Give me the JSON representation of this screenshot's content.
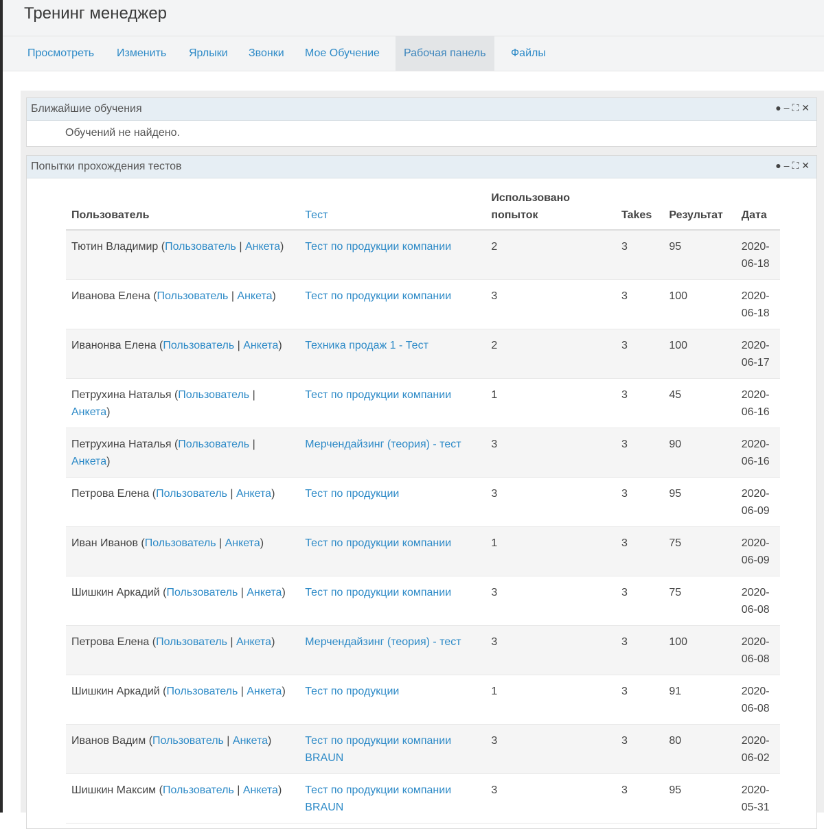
{
  "app": {
    "title": "Тренинг менеджер"
  },
  "tabs": [
    {
      "label": "Просмотреть"
    },
    {
      "label": "Изменить"
    },
    {
      "label": "Ярлыки"
    },
    {
      "label": "Звонки"
    },
    {
      "label": "Мое Обучение"
    },
    {
      "label": "Рабочая панель",
      "active": true
    },
    {
      "label": "Файлы"
    }
  ],
  "block_icons": [
    "settings-icon",
    "minimize-icon",
    "expand-icon",
    "close-icon"
  ],
  "upcoming": {
    "title": "Ближайшие обучения",
    "empty": "Обучений не найдено."
  },
  "attempts": {
    "title": "Попытки прохождения тестов",
    "links": {
      "user": "Пользователь",
      "profile": "Анкета",
      "sep": " | "
    },
    "columns": {
      "user": "Пользователь",
      "test": "Тест",
      "used": "Использовано попыток",
      "takes": "Takes",
      "result": "Результат",
      "date": "Дата"
    },
    "rows": [
      {
        "name": "Тютин Владимир",
        "test": "Тест по продукции компании",
        "used": "2",
        "takes": "3",
        "result": "95",
        "date": "2020-06-18"
      },
      {
        "name": "Иванова Елена",
        "test": "Тест по продукции компании",
        "used": "3",
        "takes": "3",
        "result": "100",
        "date": "2020-06-18"
      },
      {
        "name": "Иванонва Елена",
        "test": "Техника продаж 1 - Тест",
        "used": "2",
        "takes": "3",
        "result": "100",
        "date": "2020-06-17"
      },
      {
        "name": "Петрухина Наталья",
        "test": "Тест по продукции компании",
        "used": "1",
        "takes": "3",
        "result": "45",
        "date": "2020-06-16"
      },
      {
        "name": "Петрухина Наталья",
        "test": "Мерчендайзинг (теория) - тест",
        "used": "3",
        "takes": "3",
        "result": "90",
        "date": "2020-06-16"
      },
      {
        "name": "Петрова Елена",
        "test": "Тест по продукции",
        "used": "3",
        "takes": "3",
        "result": "95",
        "date": "2020-06-09"
      },
      {
        "name": "Иван Иванов",
        "test": "Тест по продукции компании",
        "used": "1",
        "takes": "3",
        "result": "75",
        "date": "2020-06-09"
      },
      {
        "name": "Шишкин Аркадий",
        "test": "Тест по продукции компании",
        "used": "3",
        "takes": "3",
        "result": "75",
        "date": "2020-06-08"
      },
      {
        "name": "Петрова Елена",
        "test": "Мерчендайзинг (теория) - тест",
        "used": "3",
        "takes": "3",
        "result": "100",
        "date": "2020-06-08"
      },
      {
        "name": "Шишкин Аркадий",
        "test": "Тест по продукции",
        "used": "1",
        "takes": "3",
        "result": "91",
        "date": "2020-06-08"
      },
      {
        "name": "Иванов Вадим",
        "test": "Тест по продукции компании BRAUN",
        "used": "3",
        "takes": "3",
        "result": "80",
        "date": "2020-06-02"
      },
      {
        "name": "Шишкин Максим",
        "test": "Тест по продукции компании BRAUN",
        "used": "3",
        "takes": "3",
        "result": "95",
        "date": "2020-05-31"
      }
    ]
  }
}
